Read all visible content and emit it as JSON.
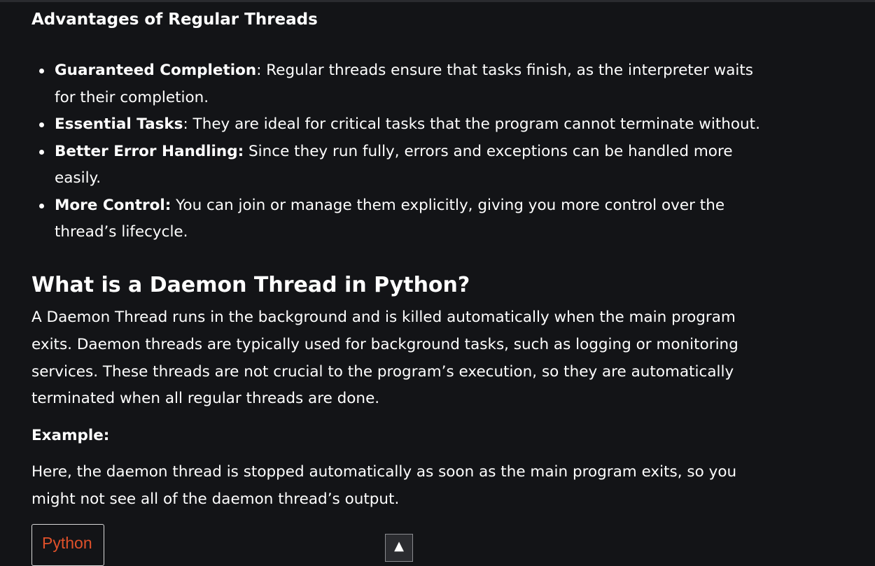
{
  "colors": {
    "background": "#131417",
    "text": "#ffffff",
    "code_tab_accent": "#e0512a"
  },
  "advantages": {
    "heading": "Advantages of Regular Threads",
    "items": [
      {
        "term": "Guaranteed Completion",
        "text": ": Regular threads ensure that tasks finish, as the interpreter waits for their completion."
      },
      {
        "term": "Essential Tasks",
        "text": ": They are ideal for critical tasks that the program cannot terminate without."
      },
      {
        "term": "Better Error Handling:",
        "text": " Since they run fully, errors and exceptions can be handled more easily."
      },
      {
        "term": "More Control:",
        "text": " You can join or manage them explicitly, giving you more control over the thread’s lifecycle."
      }
    ]
  },
  "daemon": {
    "title": "What is a Daemon Thread in Python?",
    "intro": "A Daemon Thread runs in the background and is killed automatically when the main program exits. Daemon threads are typically used for background tasks, such as logging or monitoring services. These threads are not crucial to the program’s execution, so they are automatically terminated when all regular threads are done.",
    "example_label": "Example:",
    "example_text": "Here, the daemon thread is stopped automatically as soon as the main program exits, so you might not see all of the daemon thread’s output."
  },
  "code_block": {
    "language_tab": "Python"
  },
  "scroll_top": {
    "icon": "arrow-up-icon",
    "glyph": "▲"
  }
}
